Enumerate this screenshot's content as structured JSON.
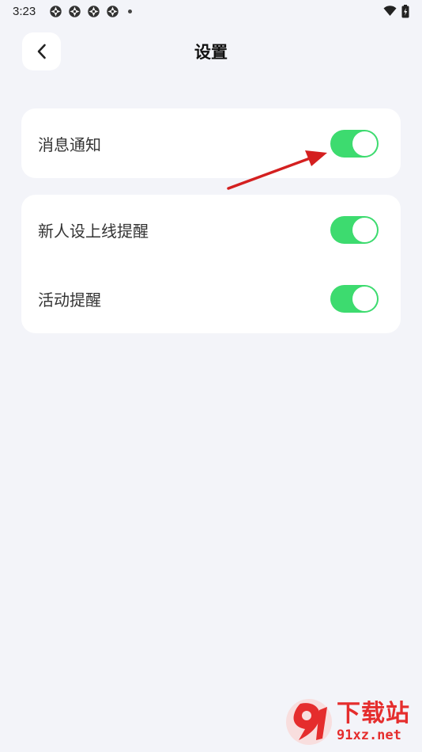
{
  "status_bar": {
    "time": "3:23",
    "notification_icons": [
      "app-notification-icon",
      "app-notification-icon",
      "app-notification-icon",
      "app-notification-icon"
    ],
    "right_icons": [
      "wifi-icon",
      "battery-charging-icon"
    ]
  },
  "header": {
    "title": "设置",
    "back_icon": "chevron-left-icon"
  },
  "settings": {
    "notification": {
      "label": "消息通知",
      "enabled": true
    },
    "newcomer_online": {
      "label": "新人设上线提醒",
      "enabled": true
    },
    "activity": {
      "label": "活动提醒",
      "enabled": true
    }
  },
  "colors": {
    "toggle_on": "#3ddb6f",
    "background": "#f3f4f9",
    "annotation_arrow": "#d42020",
    "watermark": "#e52d2d"
  },
  "watermark": {
    "title": "下载站",
    "url": "91xz.net"
  }
}
